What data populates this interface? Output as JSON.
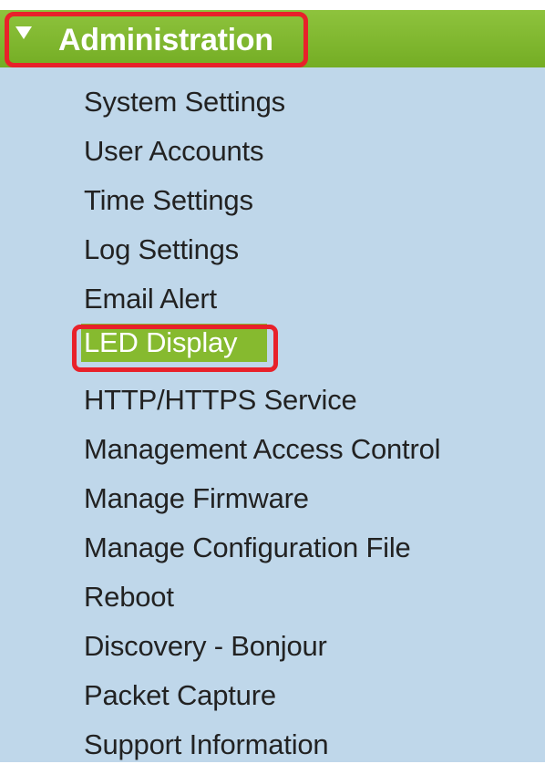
{
  "header": {
    "title": "Administration",
    "expanded": true,
    "arrow_icon": "triangle-down-icon",
    "color": "#7cb72d"
  },
  "items": [
    {
      "label": "System Settings",
      "selected": false
    },
    {
      "label": "User Accounts",
      "selected": false
    },
    {
      "label": "Time Settings",
      "selected": false
    },
    {
      "label": "Log Settings",
      "selected": false
    },
    {
      "label": "Email Alert",
      "selected": false
    },
    {
      "label": "LED Display",
      "selected": true
    },
    {
      "label": "HTTP/HTTPS Service",
      "selected": false
    },
    {
      "label": "Management Access Control",
      "selected": false
    },
    {
      "label": "Manage Firmware",
      "selected": false
    },
    {
      "label": "Manage Configuration File",
      "selected": false
    },
    {
      "label": "Reboot",
      "selected": false
    },
    {
      "label": "Discovery - Bonjour",
      "selected": false
    },
    {
      "label": "Packet Capture",
      "selected": false
    },
    {
      "label": "Support Information",
      "selected": false
    }
  ],
  "colors": {
    "menu_background": "#bfd7ea",
    "selected_background": "#86ba2f",
    "highlight_border": "#e8212a"
  }
}
